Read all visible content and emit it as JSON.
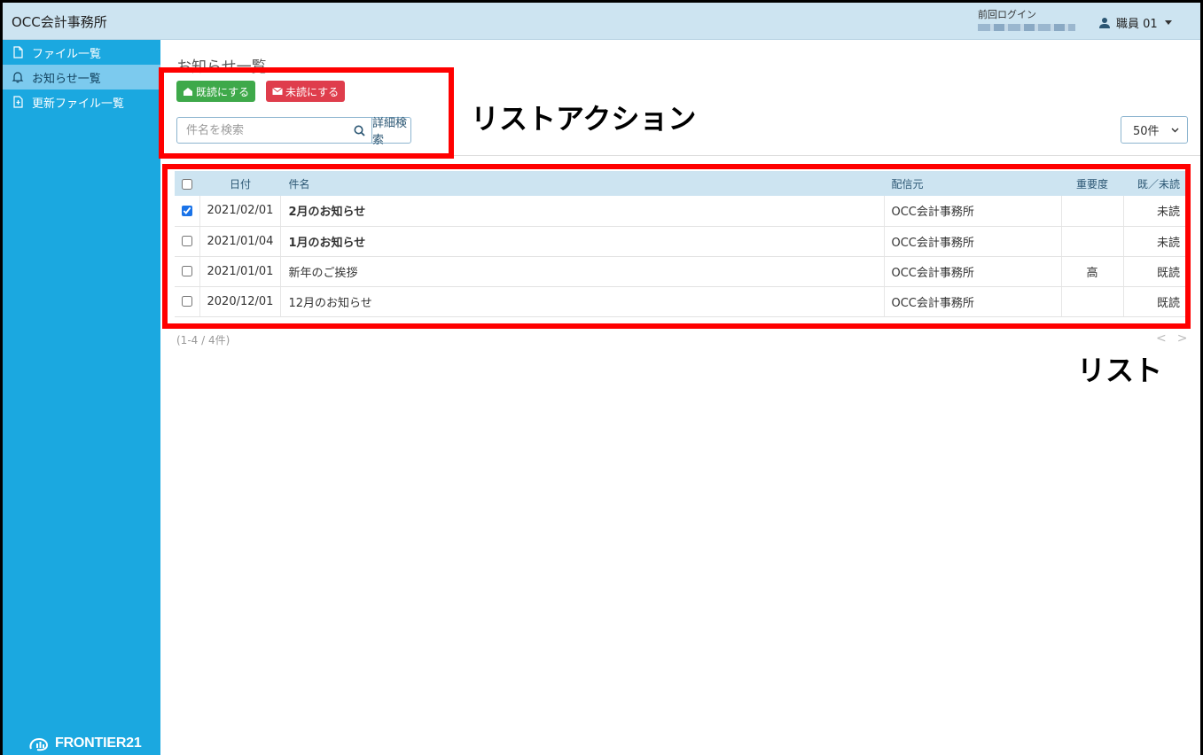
{
  "header": {
    "app_title": "OCC会計事務所",
    "last_login_label": "前回ログイン",
    "user_name": "職員 01"
  },
  "sidebar": {
    "items": [
      {
        "label": "ファイル一覧",
        "icon": "file-icon"
      },
      {
        "label": "お知らせ一覧",
        "icon": "bell-icon",
        "active": true
      },
      {
        "label": "更新ファイル一覧",
        "icon": "file-update-icon"
      }
    ],
    "brand": "FRONTIER21"
  },
  "main": {
    "title": "お知らせ一覧",
    "mark_read_label": "既読にする",
    "mark_unread_label": "未読にする",
    "search_placeholder": "件名を検索",
    "advanced_search_label": "詳細検索",
    "per_page": "50件",
    "table": {
      "headers": [
        "日付",
        "件名",
        "配信元",
        "重要度",
        "既／未読"
      ],
      "rows": [
        {
          "checked": true,
          "date": "2021/02/01",
          "subject": "2月のお知らせ",
          "sender": "OCC会計事務所",
          "importance": "",
          "status": "未読"
        },
        {
          "checked": false,
          "date": "2021/01/04",
          "subject": "1月のお知らせ",
          "sender": "OCC会計事務所",
          "importance": "",
          "status": "未読"
        },
        {
          "checked": false,
          "date": "2021/01/01",
          "subject": "新年のご挨拶",
          "sender": "OCC会計事務所",
          "importance": "高",
          "status": "既読"
        },
        {
          "checked": false,
          "date": "2020/12/01",
          "subject": "12月のお知らせ",
          "sender": "OCC会計事務所",
          "importance": "",
          "status": "既読"
        }
      ]
    },
    "count_text": "(1-4 / 4件)",
    "pager_prev": "<",
    "pager_next": ">"
  },
  "annotations": {
    "list_actions": "リストアクション",
    "list": "リスト"
  },
  "colors": {
    "sidebar": "#1ba8e0",
    "header": "#cde4f1",
    "read_button": "#3ea94a",
    "unread_button": "#df3d4c",
    "annotation": "#ff0000"
  }
}
